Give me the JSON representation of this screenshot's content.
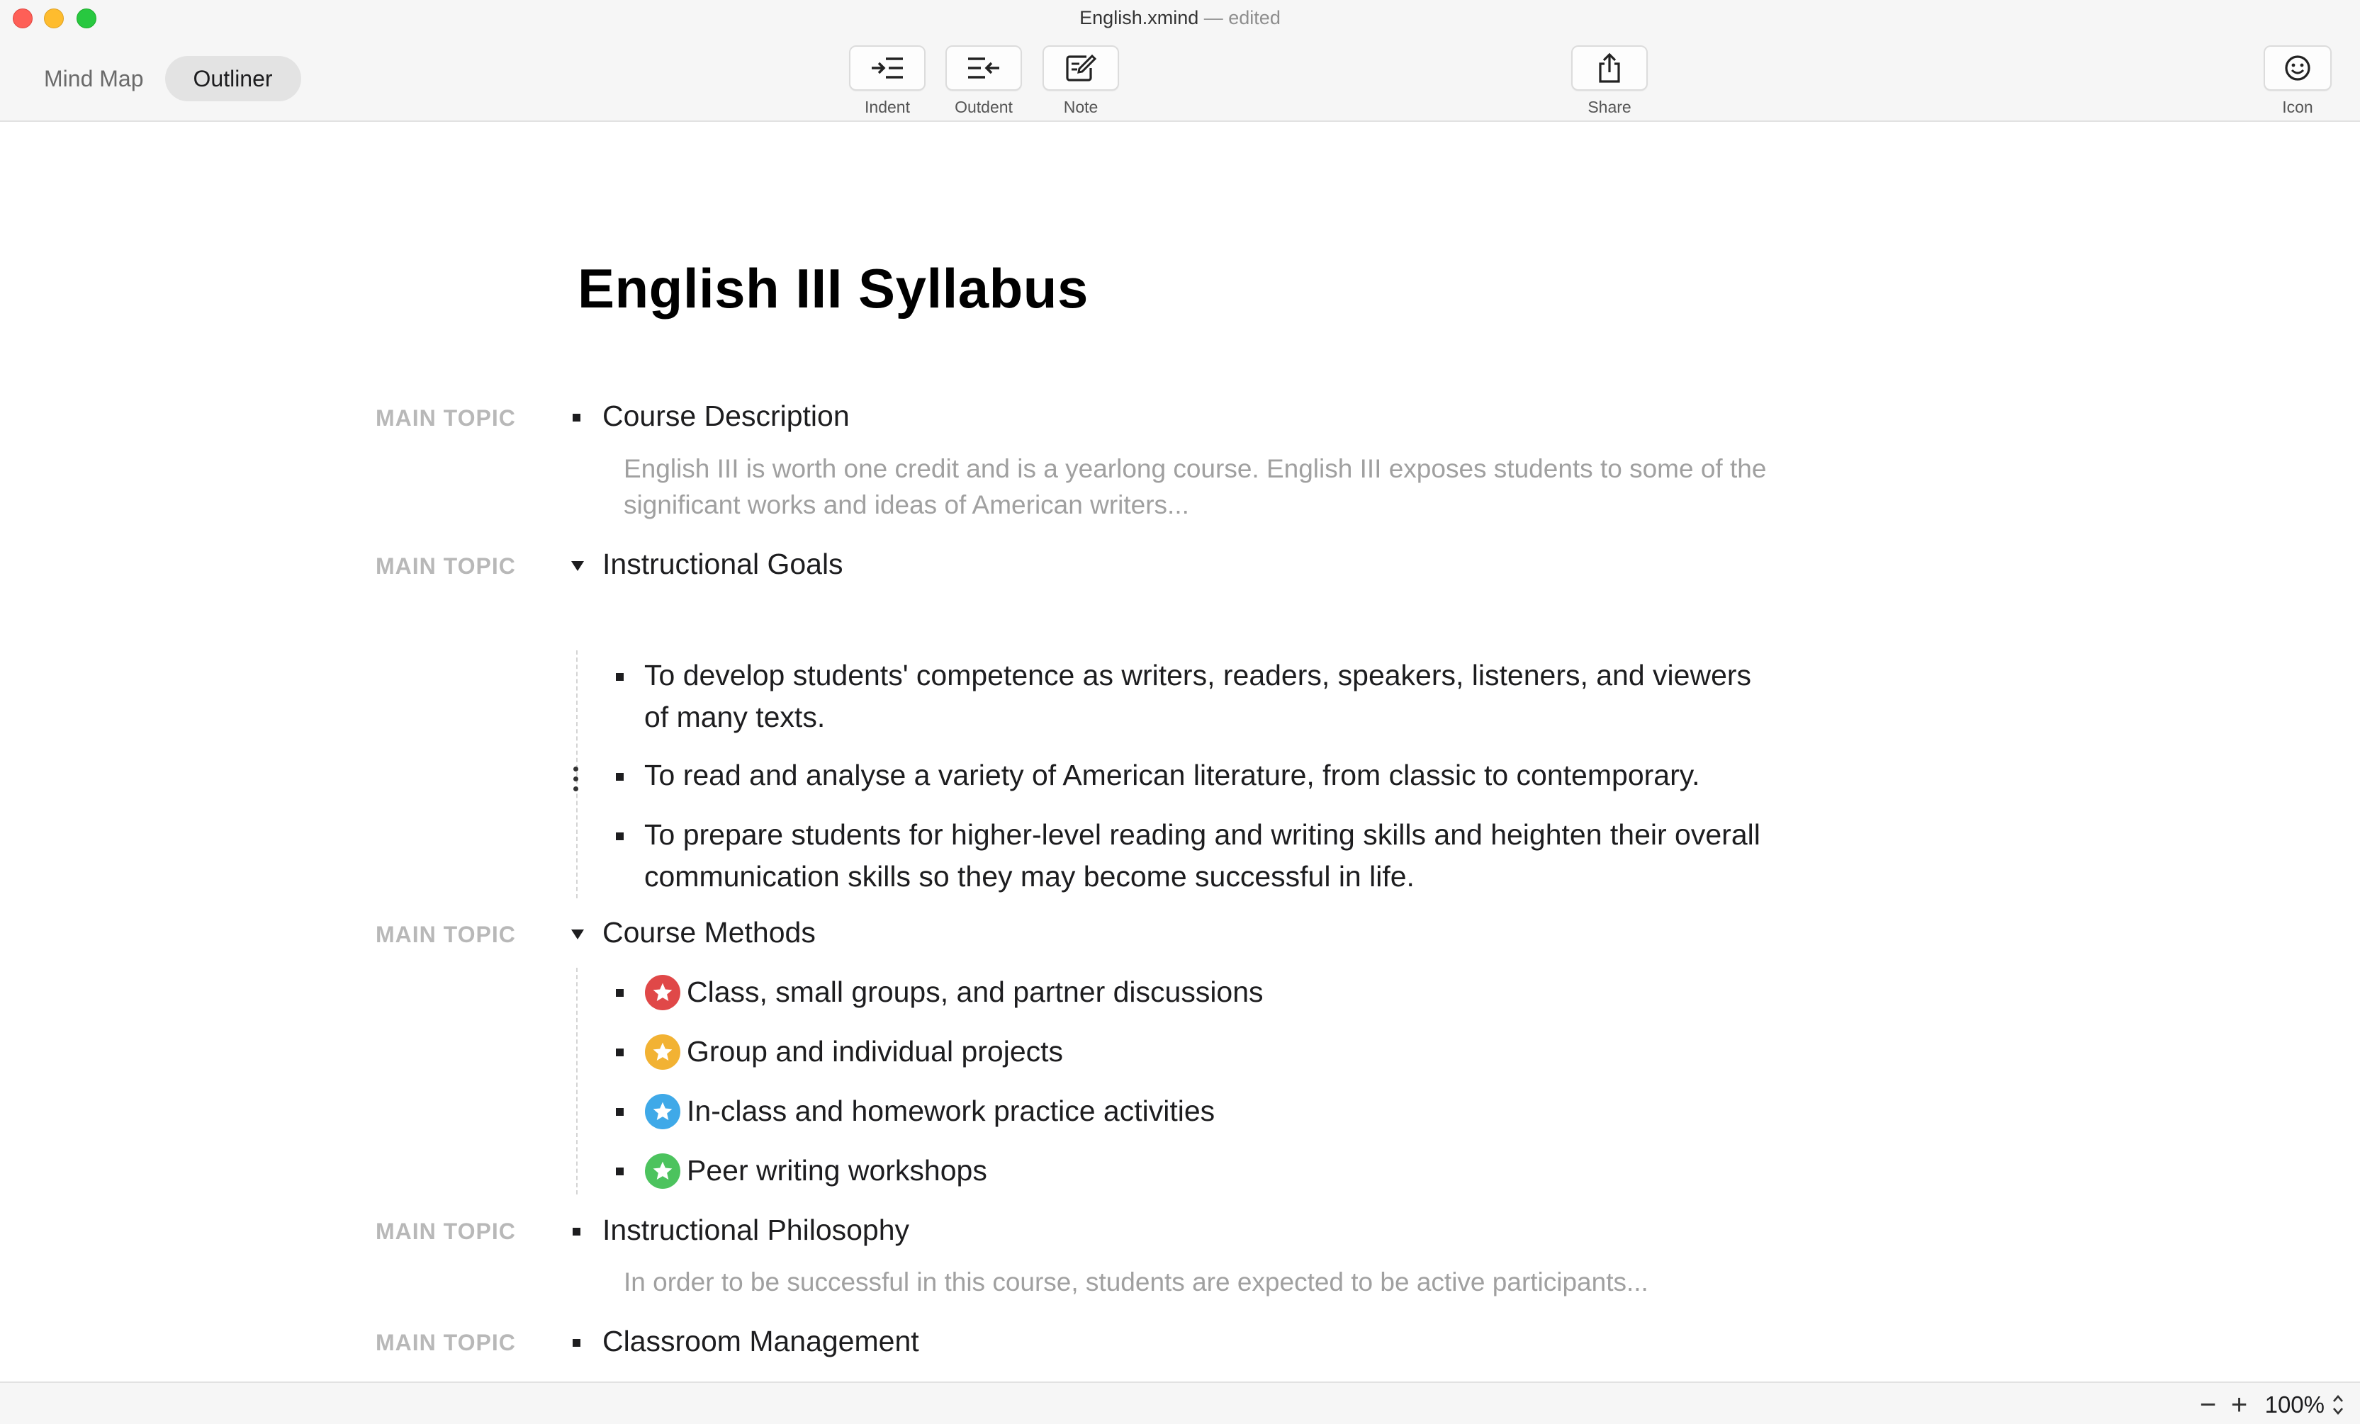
{
  "window": {
    "title": "English.xmind",
    "separator": "—",
    "status": "edited"
  },
  "views": {
    "mind_map": "Mind Map",
    "outliner": "Outliner",
    "active": "Outliner"
  },
  "toolbar": {
    "indent": "Indent",
    "outdent": "Outdent",
    "note": "Note",
    "share": "Share",
    "icon": "Icon"
  },
  "document": {
    "title": "English III Syllabus",
    "topic_tag": "MAIN TOPIC",
    "topics": [
      {
        "label": "Course Description",
        "expanded": false,
        "note_line1": "English III is worth one credit and is a yearlong course. English III exposes students to some of the",
        "note_line2": "significant works and ideas of American writers..."
      },
      {
        "label": "Instructional Goals",
        "expanded": true,
        "children": [
          {
            "line1": "To develop students' competence as writers, readers, speakers, listeners, and viewers",
            "line2": "of many texts."
          },
          {
            "line1": "To read and analyse a variety of American literature, from classic to contemporary."
          },
          {
            "line1": "To prepare students for higher-level reading and writing skills and heighten their overall",
            "line2": "communication skills so they may become successful in life."
          }
        ]
      },
      {
        "label": "Course Methods",
        "expanded": true,
        "children": [
          {
            "label": "Class, small groups, and partner discussions",
            "marker": "red-star-icon",
            "color": "#e04848"
          },
          {
            "label": "Group and individual projects",
            "marker": "orange-star-icon",
            "color": "#f2b233"
          },
          {
            "label": "In-class and homework practice activities",
            "marker": "blue-star-icon",
            "color": "#3fa9e8"
          },
          {
            "label": "Peer writing workshops",
            "marker": "green-star-icon",
            "color": "#4cc35e"
          }
        ]
      },
      {
        "label": "Instructional Philosophy",
        "expanded": false,
        "note_line1": "In order to be successful in this course, students are expected to be active participants..."
      },
      {
        "label": "Classroom Management",
        "expanded": false
      }
    ]
  },
  "statusbar": {
    "zoom_out": "−",
    "zoom_in": "+",
    "zoom": "100%"
  }
}
